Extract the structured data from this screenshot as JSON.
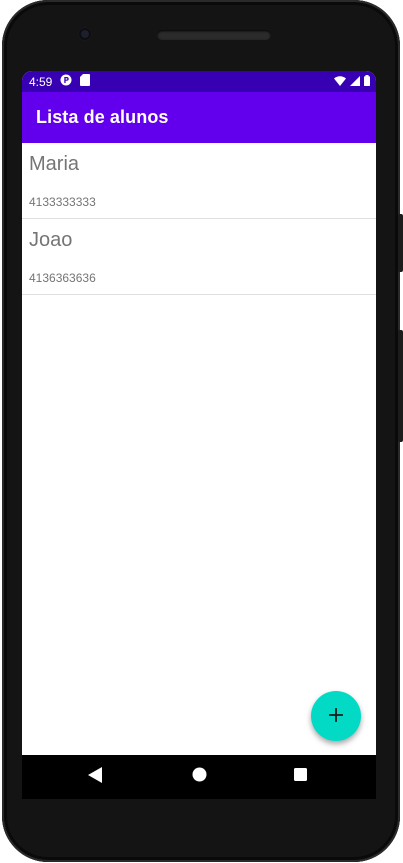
{
  "status_bar": {
    "time": "4:59",
    "left_icons": [
      "p-badge-icon",
      "sd-card-icon"
    ],
    "right_icons": [
      "wifi-icon",
      "cell-signal-icon",
      "battery-icon"
    ]
  },
  "app_bar": {
    "title": "Lista de alunos"
  },
  "students": [
    {
      "name": "Maria",
      "phone": "4133333333"
    },
    {
      "name": "Joao",
      "phone": "4136363636"
    }
  ],
  "fab": {
    "icon": "plus-icon"
  },
  "nav_bar": {
    "icons": [
      "back-icon",
      "home-icon",
      "recents-icon"
    ]
  },
  "colors": {
    "status_bar": "#3700b3",
    "app_bar": "#6200ee",
    "fab": "#03dac5",
    "text_secondary": "#757575"
  }
}
